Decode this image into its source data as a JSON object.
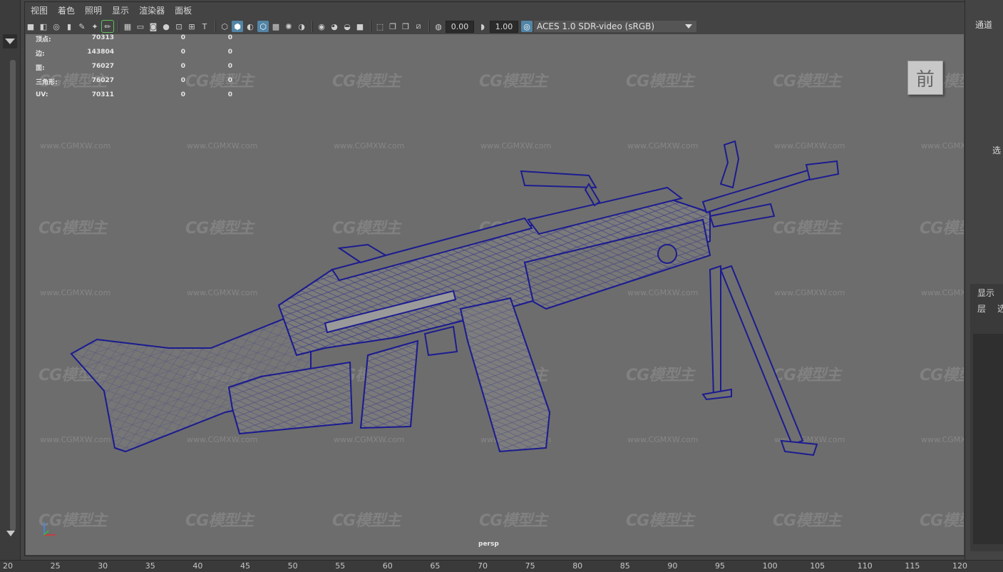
{
  "menubar": {
    "items": [
      "视图",
      "着色",
      "照明",
      "显示",
      "渲染器",
      "面板"
    ]
  },
  "toolbar": {
    "exposure_value": "0.00",
    "gamma_value": "1.00",
    "color_space": "ACES 1.0 SDR-video (sRGB)"
  },
  "hud": {
    "rows": [
      {
        "label": "顶点:",
        "v1": "70313",
        "v2": "0",
        "v3": "0"
      },
      {
        "label": "边:",
        "v1": "143804",
        "v2": "0",
        "v3": "0"
      },
      {
        "label": "面:",
        "v1": "76027",
        "v2": "0",
        "v3": "0"
      },
      {
        "label": "三角形:",
        "v1": "76027",
        "v2": "0",
        "v3": "0"
      },
      {
        "label": "UV:",
        "v1": "70311",
        "v2": "0",
        "v3": "0"
      }
    ]
  },
  "viewport": {
    "camera": "persp",
    "viewcube_face": "前",
    "watermark_logo": "CG模型主",
    "watermark_url": "www.CGMXW.com",
    "wire_color": "#1a1a8c",
    "model_fill": "#7a7a7a"
  },
  "right_panel": {
    "channels_tab": "通道",
    "select_label": "选",
    "display_tab": "显示",
    "layer_label": "层",
    "select_label2": "选"
  },
  "timeline": {
    "ticks": [
      "20",
      "25",
      "30",
      "35",
      "40",
      "45",
      "50",
      "55",
      "60",
      "65",
      "70",
      "75",
      "80",
      "85",
      "90",
      "95",
      "100",
      "105",
      "110",
      "115",
      "120"
    ]
  }
}
